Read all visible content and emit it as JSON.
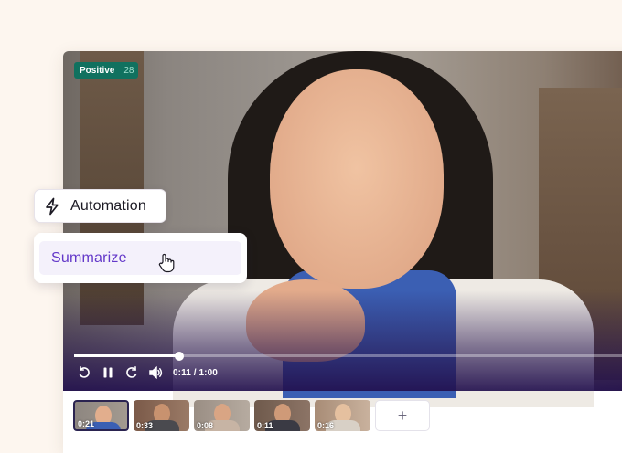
{
  "sentiment_badge": {
    "label": "Positive",
    "count": "28",
    "color": "#10715f"
  },
  "player": {
    "progress": 0.183,
    "time_display": "0:11 / 1:00",
    "controls": [
      {
        "name": "rewind-icon"
      },
      {
        "name": "pause-icon"
      },
      {
        "name": "forward-icon"
      },
      {
        "name": "volume-icon"
      }
    ]
  },
  "clips": [
    {
      "time": "0:21",
      "active": true
    },
    {
      "time": "0:33",
      "active": false
    },
    {
      "time": "0:08",
      "active": false
    },
    {
      "time": "0:11",
      "active": false
    },
    {
      "time": "0:16",
      "active": false
    }
  ],
  "add_clip": {
    "label": "+"
  },
  "automation": {
    "label": "Automation",
    "icon": "lightning-bolt-icon"
  },
  "menu": {
    "item_label": "Summarize",
    "accent": "#6338c9"
  }
}
